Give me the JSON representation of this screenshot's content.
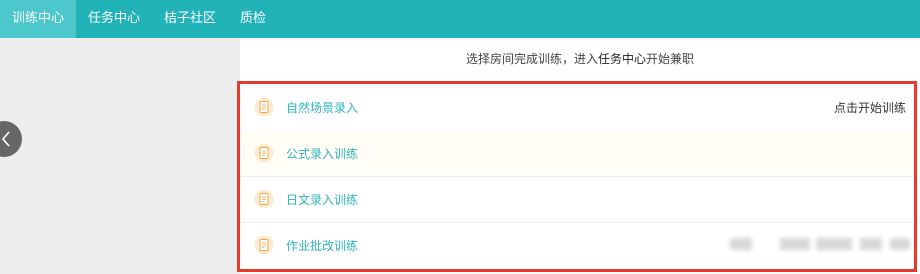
{
  "nav": {
    "tabs": [
      {
        "label": "训练中心"
      },
      {
        "label": "任务中心"
      },
      {
        "label": "桔子社区"
      },
      {
        "label": "质检"
      }
    ]
  },
  "hint": {
    "prefix": "选择房间完成训练，进入",
    "emphasis": "任务中心",
    "suffix": "开始兼职"
  },
  "trainings": {
    "items": [
      {
        "label": "自然场景录入",
        "action": "点击开始训练"
      },
      {
        "label": "公式录入训练"
      },
      {
        "label": "日文录入训练"
      },
      {
        "label": "作业批改训练"
      }
    ]
  },
  "colors": {
    "nav_bg": "#22b3b8",
    "nav_active": "#4cc8cc",
    "item_text": "#2fb6bc",
    "highlight_border": "#e63a2e",
    "icon_accent": "#f6a74a"
  },
  "icons": {
    "row_icon": "document-icon",
    "back": "chevron-left-icon"
  }
}
